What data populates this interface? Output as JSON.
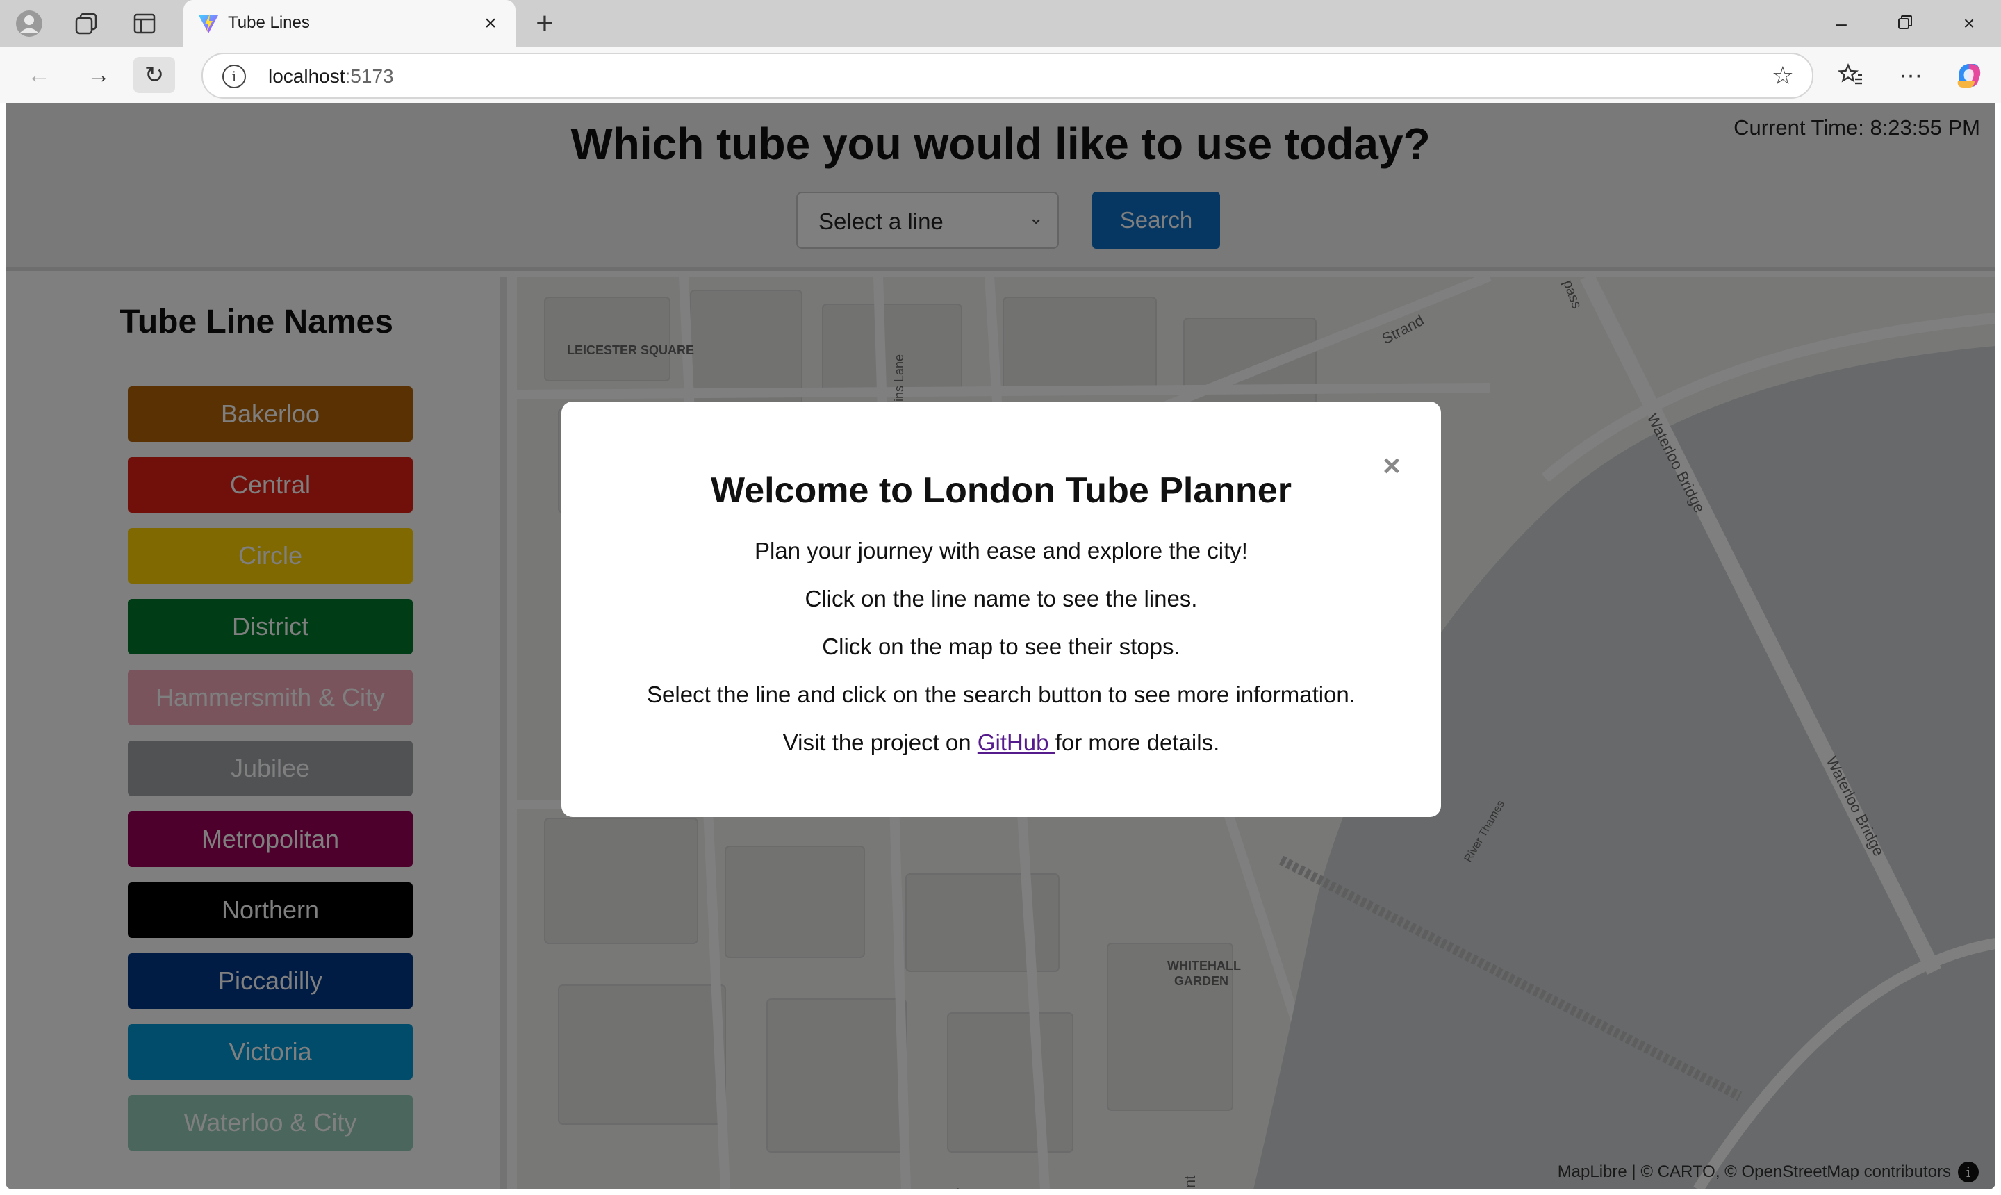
{
  "browser": {
    "tab_title": "Tube Lines",
    "url_host": "localhost",
    "url_port": ":5173"
  },
  "header": {
    "title": "Which tube you would like to use today?",
    "select_placeholder": "Select a line",
    "search_label": "Search",
    "clock": "Current Time: 8:23:55 PM"
  },
  "sidebar": {
    "title": "Tube Line Names",
    "lines": [
      {
        "name": "Bakerloo",
        "color": "#B36305",
        "text": "#ffffff"
      },
      {
        "name": "Central",
        "color": "#E32017",
        "text": "#ffffff"
      },
      {
        "name": "Circle",
        "color": "#FFD300",
        "text": "#ffffff"
      },
      {
        "name": "District",
        "color": "#00782A",
        "text": "#ffffff"
      },
      {
        "name": "Hammersmith & City",
        "color": "#F3A9BB",
        "text": "#ffffff"
      },
      {
        "name": "Jubilee",
        "color": "#A0A5A9",
        "text": "#ffffff"
      },
      {
        "name": "Metropolitan",
        "color": "#9B0056",
        "text": "#ffffff"
      },
      {
        "name": "Northern",
        "color": "#000000",
        "text": "#ffffff"
      },
      {
        "name": "Piccadilly",
        "color": "#003688",
        "text": "#ffffff"
      },
      {
        "name": "Victoria",
        "color": "#0098D4",
        "text": "#ffffff"
      },
      {
        "name": "Waterloo & City",
        "color": "#95CDBA",
        "text": "#ffffff"
      }
    ]
  },
  "map": {
    "labels": {
      "leicester": "LEICESTER SQUARE",
      "strand": "Strand",
      "pass": "pass",
      "lane": "ins Lane",
      "waterloo1": "Waterloo Bridge",
      "waterloo2": "Waterloo Bridge",
      "river": "River Thames",
      "whitehall1": "WHITEHALL",
      "whitehall2": "GARDEN",
      "wh": "Wh",
      "nt": "nt"
    },
    "attribution": {
      "maplibre": "MapLibre",
      "sep": " | © ",
      "carto": "CARTO",
      "sep2": ", © ",
      "osm": "OpenStreetMap",
      "contrib": " contributors"
    }
  },
  "modal": {
    "close": "×",
    "title": "Welcome to London Tube Planner",
    "p1": "Plan your journey with ease and explore the city!",
    "p2": "Click on the line name to see the lines.",
    "p3": "Click on the map to see their stops.",
    "p4": "Select the line and click on the search button to see more information.",
    "p5_before": "Visit the project on ",
    "p5_link": "GitHub ",
    "p5_after": "for more details."
  }
}
